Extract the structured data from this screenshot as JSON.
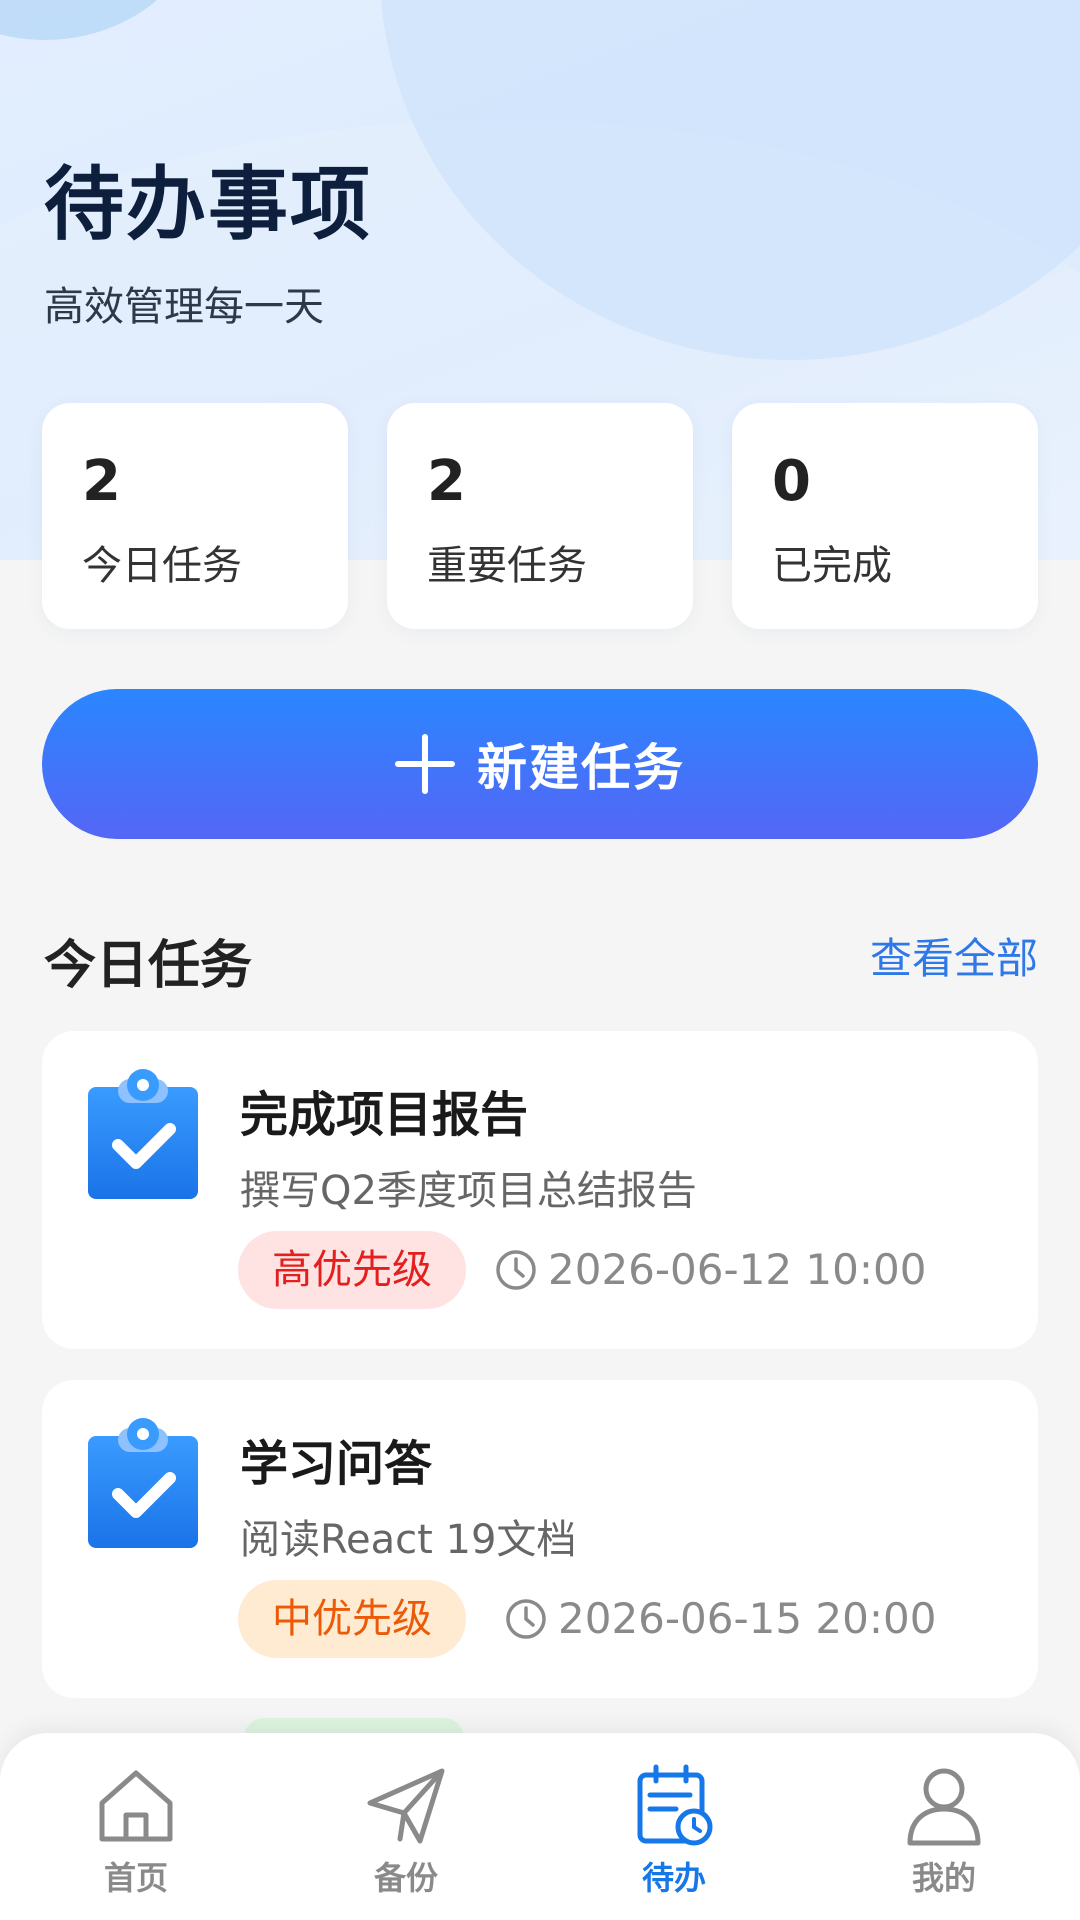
{
  "header": {
    "title": "待办事项",
    "subtitle": "高效管理每一天"
  },
  "stats": [
    {
      "value": "2",
      "label": "今日任务"
    },
    {
      "value": "2",
      "label": "重要任务"
    },
    {
      "value": "0",
      "label": "已完成"
    }
  ],
  "new_task_button": {
    "label": "新建任务"
  },
  "today_section": {
    "title": "今日任务",
    "see_all": "查看全部"
  },
  "tasks": [
    {
      "title": "完成项目报告",
      "description": "撰写Q2季度项目总结报告",
      "priority": "高优先级",
      "time": "2026-06-12 10:00"
    },
    {
      "title": "学习问答",
      "description": "阅读React 19文档",
      "priority": "中优先级",
      "time": "2026-06-15 20:00"
    }
  ],
  "tabbar": {
    "items": [
      {
        "label": "首页",
        "icon": "home-icon"
      },
      {
        "label": "备份",
        "icon": "paper-plane-icon"
      },
      {
        "label": "待办",
        "icon": "calendar-clock-icon",
        "active": true
      },
      {
        "label": "我的",
        "icon": "user-icon"
      }
    ]
  },
  "colors": {
    "accent": "#1677e8",
    "high_priority": "#e3201d",
    "mid_priority": "#ec5a07"
  }
}
